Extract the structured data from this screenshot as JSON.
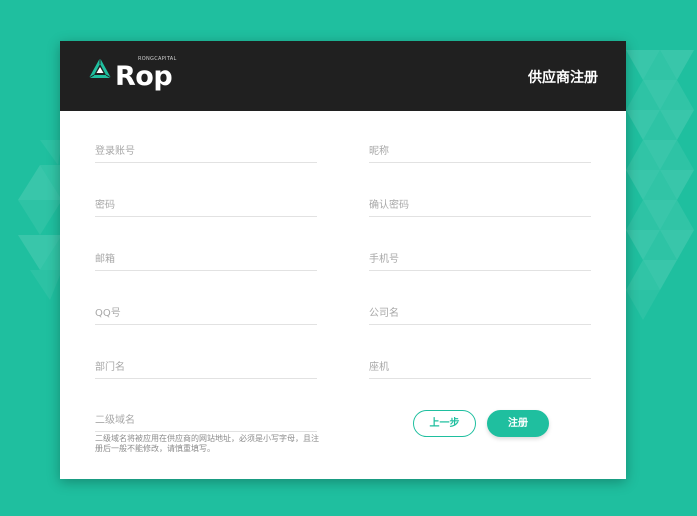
{
  "colors": {
    "accent": "#1fbf9f",
    "header_bg": "#202020",
    "background": "#1fbf9f"
  },
  "brand": {
    "logo_text": "Rop",
    "logo_sub": "RONGCAPITAL",
    "logo_icon": "triangle-logo-icon"
  },
  "header": {
    "title": "供应商注册"
  },
  "form": {
    "login_account": {
      "placeholder": "登录账号",
      "value": ""
    },
    "nickname": {
      "placeholder": "昵称",
      "value": ""
    },
    "password": {
      "placeholder": "密码",
      "value": ""
    },
    "confirm_password": {
      "placeholder": "确认密码",
      "value": ""
    },
    "email": {
      "placeholder": "邮箱",
      "value": ""
    },
    "phone": {
      "placeholder": "手机号",
      "value": ""
    },
    "qq": {
      "placeholder": "QQ号",
      "value": ""
    },
    "company": {
      "placeholder": "公司名",
      "value": ""
    },
    "department": {
      "placeholder": "部门名",
      "value": ""
    },
    "landline": {
      "placeholder": "座机",
      "value": ""
    },
    "subdomain": {
      "placeholder": "二级域名",
      "value": ""
    },
    "subdomain_hint": "二级域名将被应用在供应商的网站地址，必须是小写字母，且注册后一般不能修改，请慎重填写。"
  },
  "buttons": {
    "prev_label": "上一步",
    "register_label": "注册"
  }
}
